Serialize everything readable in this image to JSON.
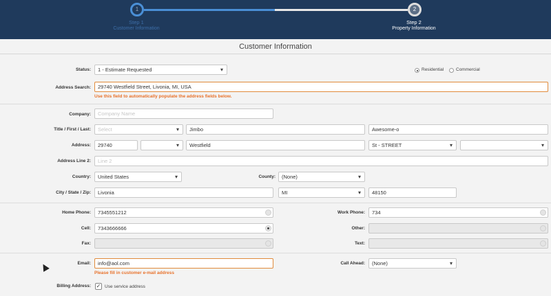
{
  "stepper": {
    "step1": {
      "number": "1",
      "title": "Step 1",
      "subtitle": "Customer Information"
    },
    "step2": {
      "number": "2",
      "title": "Step 2",
      "subtitle": "Property Information"
    }
  },
  "page_title": "Customer Information",
  "status": {
    "label": "Status:",
    "value": "1 - Estimate Requested"
  },
  "property_type": {
    "residential": "Residential",
    "commercial": "Commercial",
    "selected": "Residential"
  },
  "address_search": {
    "label": "Address Search:",
    "value": "29740 Westfield Street, Livonia, MI, USA",
    "hint": "Use this field to automatically populate the address fields below."
  },
  "company": {
    "label": "Company:",
    "placeholder": "Company Name"
  },
  "name": {
    "label": "Title / First / Last:",
    "title_placeholder": "Select",
    "first": "Jimbo",
    "last": "Awesome-o"
  },
  "address": {
    "label": "Address:",
    "number": "29740",
    "direction": "",
    "street": "Westfield",
    "suffix": "St - STREET",
    "unit": ""
  },
  "address2": {
    "label": "Address Line 2:",
    "placeholder": "Line 2"
  },
  "country": {
    "label": "Country:",
    "value": "United States"
  },
  "county": {
    "label": "County:",
    "value": "(None)"
  },
  "city": {
    "label": "City / State / Zip:",
    "city": "Livonia",
    "state": "MI",
    "zip": "48150"
  },
  "phones": {
    "home_label": "Home Phone:",
    "home": "7345551212",
    "cell_label": "Cell:",
    "cell": "7343666666",
    "fax_label": "Fax:",
    "fax": "",
    "work_label": "Work Phone:",
    "work": "734",
    "other_label": "Other:",
    "other": "",
    "text_label": "Text:",
    "text": ""
  },
  "email": {
    "label": "Email:",
    "value": "info@aol.com",
    "hint": "Please fill in customer e-mail address"
  },
  "call_ahead": {
    "label": "Call Ahead:",
    "value": "(None)"
  },
  "billing": {
    "label": "Billing Address:",
    "checkbox_label": "Use service address",
    "checked": true
  }
}
